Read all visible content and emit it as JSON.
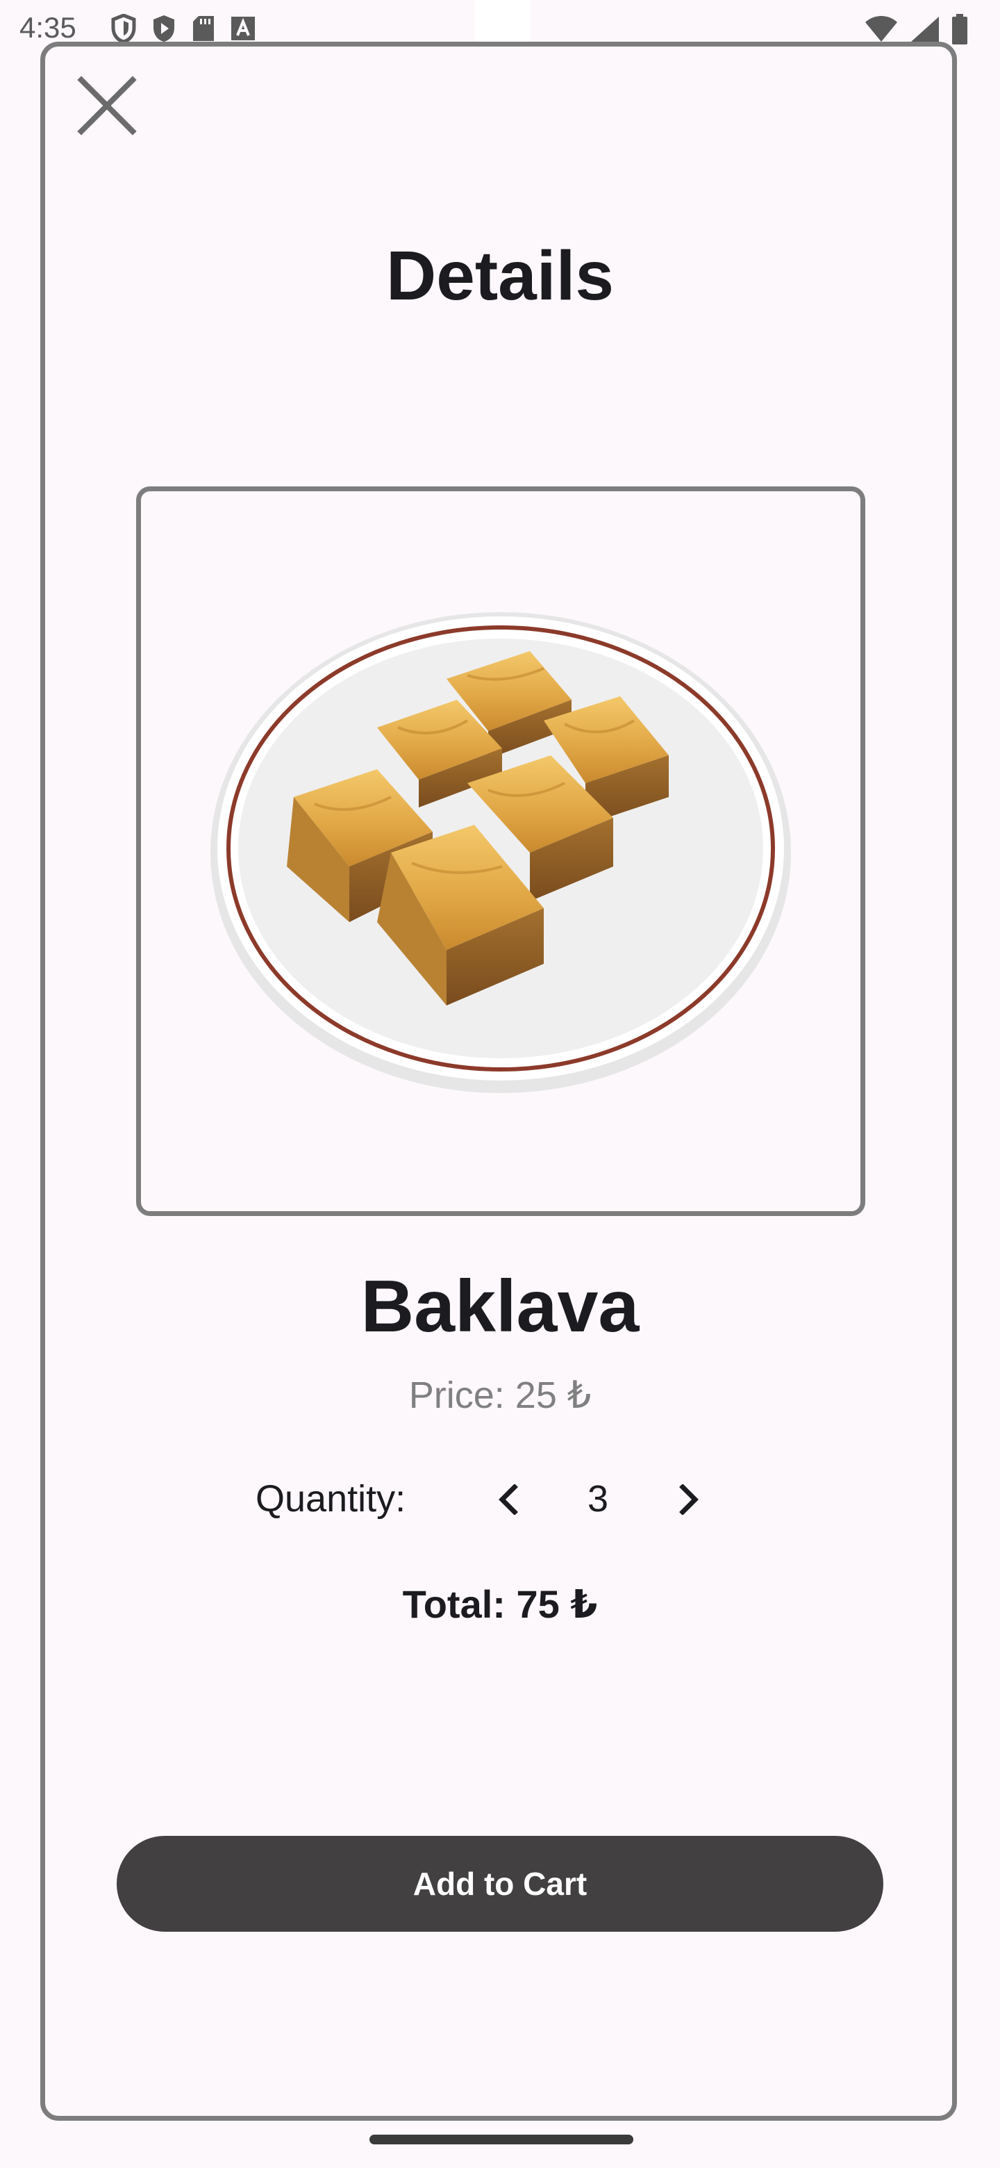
{
  "status_bar": {
    "time": "4:35",
    "left_icons": [
      "vpn-shield-icon",
      "play-store-icon",
      "sd-card-icon",
      "font-a-icon"
    ],
    "right_icons": [
      "wifi-icon",
      "cell-signal-icon",
      "battery-icon"
    ]
  },
  "dialog": {
    "title": "Details",
    "close_icon": "close-icon"
  },
  "product": {
    "image_name": "baklava-image",
    "name": "Baklava",
    "price": "Price: 25 ₺"
  },
  "quantity": {
    "label": "Quantity:",
    "value": "3",
    "prev_icon": "chevron-left-icon",
    "next_icon": "chevron-right-icon"
  },
  "total": "Total: 75 ₺",
  "actions": {
    "add_to_cart": "Add to Cart"
  },
  "colors": {
    "background": "#fcf8fc",
    "frame_border": "#7d7d7d",
    "button_bg": "#424041",
    "button_text": "#ffffff",
    "muted_text": "#808080"
  }
}
